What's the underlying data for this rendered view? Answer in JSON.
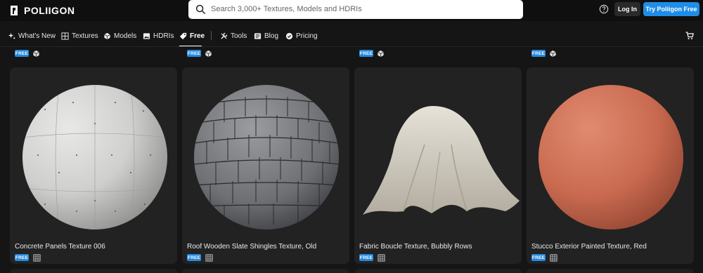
{
  "header": {
    "logo_text": "POLIIGON",
    "search_placeholder": "Search 3,000+ Textures, Models and HDRIs",
    "login_label": "Log In",
    "try_label": "Try Poliigon Free"
  },
  "nav": {
    "items": [
      {
        "label": "What's New",
        "icon": "sparkle-icon"
      },
      {
        "label": "Textures",
        "icon": "grid-icon"
      },
      {
        "label": "Models",
        "icon": "cube-icon"
      },
      {
        "label": "HDRIs",
        "icon": "image-icon"
      },
      {
        "label": "Free",
        "icon": "tag-icon",
        "active": true
      },
      {
        "label": "Tools",
        "icon": "tools-icon"
      },
      {
        "label": "Blog",
        "icon": "blog-icon"
      },
      {
        "label": "Pricing",
        "icon": "badge-icon"
      }
    ]
  },
  "badge_free": "FREE",
  "cards": [
    {
      "title": "Concrete Panels Texture 006",
      "badge": "FREE",
      "type_icon": "texture-icon"
    },
    {
      "title": "Roof Wooden Slate Shingles Texture, Old",
      "badge": "FREE",
      "type_icon": "texture-icon"
    },
    {
      "title": "Fabric Boucle Texture, Bubbly Rows",
      "badge": "FREE",
      "type_icon": "texture-icon"
    },
    {
      "title": "Stucco Exterior Painted Texture, Red",
      "badge": "FREE",
      "type_icon": "texture-icon"
    }
  ],
  "colors": {
    "accent": "#1f8de8",
    "background": "#151515",
    "card": "#222222"
  }
}
